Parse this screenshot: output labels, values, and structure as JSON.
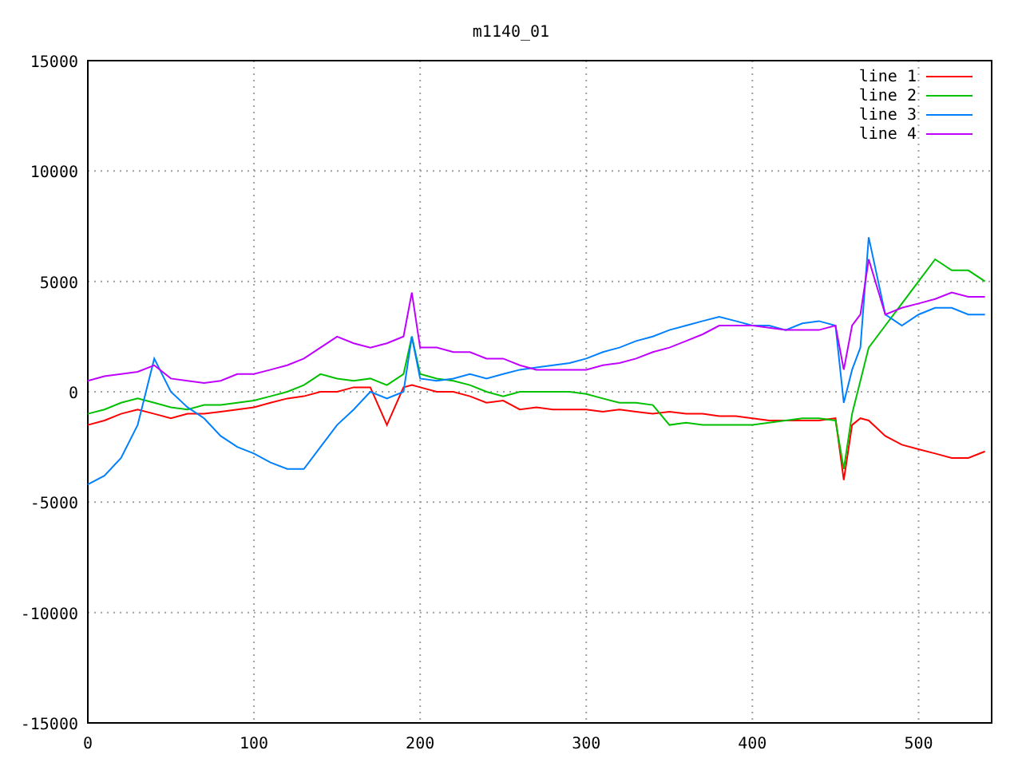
{
  "chart_data": {
    "type": "line",
    "title": "m1140_01",
    "x": [
      0,
      10,
      20,
      30,
      40,
      50,
      60,
      70,
      80,
      90,
      100,
      110,
      120,
      130,
      140,
      150,
      160,
      170,
      180,
      190,
      195,
      200,
      210,
      220,
      230,
      240,
      250,
      260,
      270,
      280,
      290,
      300,
      310,
      320,
      330,
      340,
      350,
      360,
      370,
      380,
      390,
      400,
      410,
      420,
      430,
      440,
      450,
      455,
      460,
      465,
      470,
      480,
      490,
      500,
      510,
      520,
      530,
      540
    ],
    "series": [
      {
        "name": "line 1",
        "color": "#ff0000",
        "values": [
          -1500,
          -1300,
          -1000,
          -800,
          -1000,
          -1200,
          -1000,
          -1000,
          -900,
          -800,
          -700,
          -500,
          -300,
          -200,
          0,
          0,
          200,
          200,
          -1500,
          200,
          300,
          200,
          0,
          0,
          -200,
          -500,
          -400,
          -800,
          -700,
          -800,
          -800,
          -800,
          -900,
          -800,
          -900,
          -1000,
          -900,
          -1000,
          -1000,
          -1100,
          -1100,
          -1200,
          -1300,
          -1300,
          -1300,
          -1300,
          -1200,
          -4000,
          -1500,
          -1200,
          -1300,
          -2000,
          -2400,
          -2600,
          -2800,
          -3000,
          -3000,
          -2700
        ]
      },
      {
        "name": "line 2",
        "color": "#00c000",
        "values": [
          -1000,
          -800,
          -500,
          -300,
          -500,
          -700,
          -800,
          -600,
          -600,
          -500,
          -400,
          -200,
          0,
          300,
          800,
          600,
          500,
          600,
          300,
          800,
          2500,
          800,
          600,
          500,
          300,
          0,
          -200,
          0,
          0,
          0,
          0,
          -100,
          -300,
          -500,
          -500,
          -600,
          -1500,
          -1400,
          -1500,
          -1500,
          -1500,
          -1500,
          -1400,
          -1300,
          -1200,
          -1200,
          -1300,
          -3500,
          -1000,
          500,
          2000,
          3000,
          4000,
          5000,
          6000,
          5500,
          5500,
          5000
        ]
      },
      {
        "name": "line 3",
        "color": "#0080ff",
        "values": [
          -4200,
          -3800,
          -3000,
          -1500,
          1500,
          0,
          -700,
          -1200,
          -2000,
          -2500,
          -2800,
          -3200,
          -3500,
          -3500,
          -2500,
          -1500,
          -800,
          0,
          -300,
          0,
          2500,
          600,
          500,
          600,
          800,
          600,
          800,
          1000,
          1100,
          1200,
          1300,
          1500,
          1800,
          2000,
          2300,
          2500,
          2800,
          3000,
          3200,
          3400,
          3200,
          3000,
          3000,
          2800,
          3100,
          3200,
          3000,
          -500,
          1000,
          2000,
          7000,
          3500,
          3000,
          3500,
          3800,
          3800,
          3500,
          3500
        ]
      },
      {
        "name": "line 4",
        "color": "#c000ff",
        "values": [
          500,
          700,
          800,
          900,
          1200,
          600,
          500,
          400,
          500,
          800,
          800,
          1000,
          1200,
          1500,
          2000,
          2500,
          2200,
          2000,
          2200,
          2500,
          4500,
          2000,
          2000,
          1800,
          1800,
          1500,
          1500,
          1200,
          1000,
          1000,
          1000,
          1000,
          1200,
          1300,
          1500,
          1800,
          2000,
          2300,
          2600,
          3000,
          3000,
          3000,
          2900,
          2800,
          2800,
          2800,
          3000,
          1000,
          3000,
          3500,
          6000,
          3500,
          3800,
          4000,
          4200,
          4500,
          4300,
          4300
        ]
      }
    ],
    "grid": true,
    "legend": true,
    "xlim": [
      0,
      544
    ],
    "ylim": [
      -15000,
      15000
    ],
    "xticks": [
      0,
      100,
      200,
      300,
      400,
      500
    ],
    "yticks": [
      -15000,
      -10000,
      -5000,
      0,
      5000,
      10000,
      15000
    ]
  }
}
